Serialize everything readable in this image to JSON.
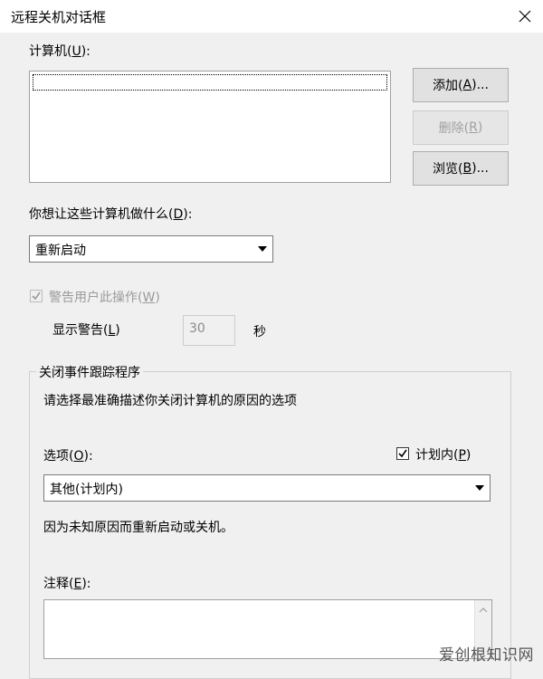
{
  "window": {
    "title": "远程关机对话框"
  },
  "computers": {
    "label_text": "计算机(",
    "label_key": "U",
    "label_end": "):",
    "list_items": []
  },
  "buttons": {
    "add": {
      "text": "添加(",
      "key": "A",
      "end": ")..."
    },
    "remove": {
      "text": "删除(",
      "key": "R",
      "end": ")"
    },
    "browse": {
      "text": "浏览(",
      "key": "B",
      "end": ")..."
    }
  },
  "action": {
    "label_text": "你想让这些计算机做什么(",
    "label_key": "D",
    "label_end": "):",
    "selected": "重新启动"
  },
  "warn": {
    "checked": true,
    "enabled": false,
    "label_text": "警告用户此操作(",
    "label_key": "W",
    "label_end": ")",
    "display_text": "显示警告(",
    "display_key": "L",
    "display_end": ")",
    "seconds_value": "30",
    "seconds_unit": "秒"
  },
  "tracker": {
    "legend": "关闭事件跟踪程序",
    "description": "请选择最准确描述你关闭计算机的原因的选项",
    "option_label_text": "选项(",
    "option_label_key": "O",
    "option_label_end": "):",
    "planned_checked": true,
    "planned_text": "计划内(",
    "planned_key": "P",
    "planned_end": ")",
    "option_selected": "其他(计划内)",
    "reason_text": "因为未知原因而重新启动或关机。",
    "comment_label_text": "注释(",
    "comment_label_key": "E",
    "comment_label_end": "):",
    "comment_value": ""
  },
  "watermark": "爱创根知识网",
  "icons": {
    "close": "close-icon",
    "dropdown": "chevron-down-icon",
    "check": "checkmark-icon"
  },
  "colors": {
    "dialog_bg": "#f0f0f0",
    "disabled_text": "#9a9a9a"
  }
}
